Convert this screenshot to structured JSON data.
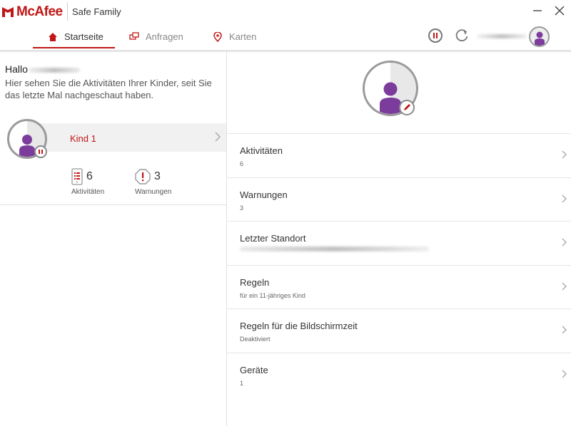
{
  "titlebar": {
    "brand": "McAfee",
    "product": "Safe Family",
    "minimize": "—",
    "close": "✕"
  },
  "nav": {
    "tabs": [
      {
        "label": "Startseite",
        "icon": "home-icon",
        "active": true
      },
      {
        "label": "Anfragen",
        "icon": "requests-icon",
        "active": false
      },
      {
        "label": "Karten",
        "icon": "map-pin-icon",
        "active": false
      }
    ]
  },
  "home": {
    "greeting": "Hallo",
    "intro": "Hier sehen Sie die Aktivitäten Ihrer Kinder, seit Sie das letzte Mal nachgeschaut haben.",
    "child_name": "Kind 1",
    "stats": {
      "activities_count": "6",
      "activities_label": "Aktivitäten",
      "warnings_count": "3",
      "warnings_label": "Warnungen"
    }
  },
  "details": {
    "items": [
      {
        "title": "Aktivitäten",
        "subtitle": "6"
      },
      {
        "title": "Warnungen",
        "subtitle": "3"
      },
      {
        "title": "Letzter Standort",
        "subtitle": ""
      },
      {
        "title": "Regeln",
        "subtitle": "für ein 11-jähriges Kind"
      },
      {
        "title": "Regeln für die Bildschirmzeit",
        "subtitle": "Deaktiviert"
      },
      {
        "title": "Geräte",
        "subtitle": "1"
      }
    ]
  },
  "colors": {
    "brand_red": "#c01818",
    "avatar_purple": "#7b3c9c",
    "divider": "#e2e2e2"
  }
}
